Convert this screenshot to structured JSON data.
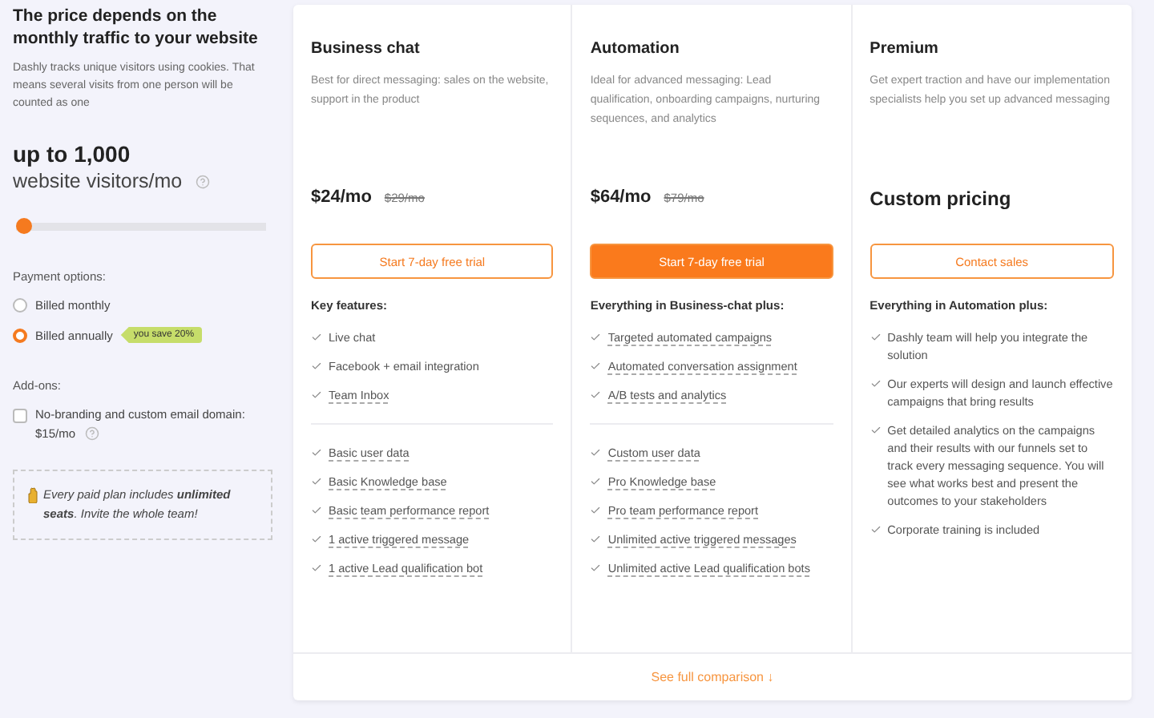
{
  "sidebar": {
    "title": "The price depends on the monthly traffic to your website",
    "description": "Dashly tracks unique visitors using cookies. That means several visits from one person will be counted as one",
    "visitors": {
      "amount": "up to 1,000",
      "unit": "website visitors/mo"
    },
    "slider": {
      "level": 0.0
    },
    "payment": {
      "label": "Payment options:",
      "options": [
        {
          "label": "Billed monthly",
          "selected": false
        },
        {
          "label": "Billed annually",
          "selected": true,
          "badge": "you save 20%"
        }
      ]
    },
    "addons": {
      "label": "Add-ons:",
      "items": [
        {
          "label": "No-branding and custom email domain:",
          "price": "$15/mo",
          "checked": false
        }
      ]
    },
    "note": "Every paid plan includes **unlimited seats**. Invite the whole team!"
  },
  "plans": [
    {
      "name": "Business chat",
      "description": "Best for direct messaging: sales on the website, support in the product",
      "price": "$24/mo",
      "old_price": "$29/mo",
      "button": {
        "label": "Start 7-day free trial",
        "highlighted": false
      },
      "feature_groups": [
        {
          "heading": "Key features:",
          "items": [
            {
              "label": "Live chat",
              "underlined": false
            },
            {
              "label": "Facebook + email integration",
              "underlined": false
            },
            {
              "label": "Team Inbox",
              "underlined": true
            }
          ]
        },
        {
          "items": [
            {
              "label": "Basic user data",
              "underlined": true
            },
            {
              "label": "Basic Knowledge base",
              "underlined": true
            },
            {
              "label": "Basic team performance report",
              "underlined": true
            },
            {
              "label": "1 active triggered message",
              "underlined": true
            },
            {
              "label": "1 active Lead qualification bot",
              "underlined": true
            }
          ]
        }
      ]
    },
    {
      "name": "Automation",
      "description": "Ideal for advanced messaging: Lead qualification, onboarding campaigns, nurturing sequences, and analytics",
      "price": "$64/mo",
      "old_price": "$79/mo",
      "button": {
        "label": "Start 7-day free trial",
        "highlighted": true
      },
      "feature_groups": [
        {
          "heading": "Everything in Business-chat plus:",
          "items": [
            {
              "label": "Targeted automated campaigns",
              "underlined": true
            },
            {
              "label": "Automated conversation assignment",
              "underlined": true
            },
            {
              "label": "A/B tests and analytics",
              "underlined": true
            }
          ]
        },
        {
          "items": [
            {
              "label": "Custom user data",
              "underlined": true
            },
            {
              "label": "Pro Knowledge base",
              "underlined": true
            },
            {
              "label": "Pro team performance report",
              "underlined": true
            },
            {
              "label": "Unlimited active triggered messages",
              "underlined": true
            },
            {
              "label": "Unlimited active Lead qualification bots",
              "underlined": true
            }
          ]
        }
      ]
    },
    {
      "name": "Premium",
      "description": "Get expert traction and have our implementation specialists help you set up advanced messaging",
      "price": "Custom pricing",
      "button": {
        "label": "Contact sales",
        "highlighted": false
      },
      "feature_groups": [
        {
          "heading": "Everything in Automation plus:",
          "items": [
            {
              "label": "Dashly team will help you integrate the solution",
              "underlined": false
            },
            {
              "label": "Our experts will design and launch effective campaigns that bring results",
              "underlined": false
            },
            {
              "label": "Get detailed analytics on the campaigns and their results with our funnels set to track every messaging sequence. You will see what works best and present the outcomes to your stakeholders",
              "underlined": false
            },
            {
              "label": "Corporate training is included",
              "underlined": false
            }
          ]
        }
      ]
    }
  ],
  "footer_link": "See full comparison ↓"
}
